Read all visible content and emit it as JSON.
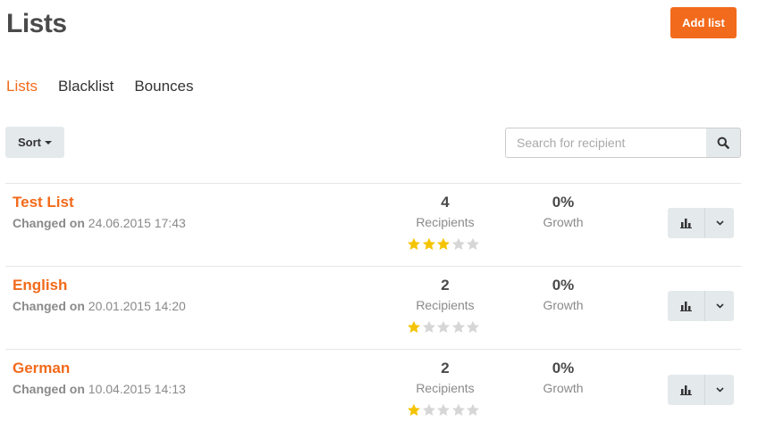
{
  "header": {
    "title": "Lists",
    "add_button_label": "Add list"
  },
  "tabs": [
    {
      "label": "Lists",
      "active": true
    },
    {
      "label": "Blacklist",
      "active": false
    },
    {
      "label": "Bounces",
      "active": false
    }
  ],
  "toolbar": {
    "sort_label": "Sort",
    "search_placeholder": "Search for recipient",
    "search_value": ""
  },
  "colors": {
    "accent": "#f26a1b",
    "star_on": "#f5c400",
    "star_off": "#d6d6d6",
    "button_bg": "#e4e9ec"
  },
  "icons": {
    "search": "search-icon",
    "chart": "bar-chart-icon",
    "dropdown": "chevron-down-icon",
    "rating": "star-icon"
  },
  "rows": [
    {
      "name": "Test List",
      "changed_label": "Changed on",
      "changed_date": "24.06.2015 17:43",
      "recipients": "4",
      "recipients_label": "Recipients",
      "growth": "0%",
      "growth_label": "Growth",
      "rating": 3
    },
    {
      "name": "English",
      "changed_label": "Changed on",
      "changed_date": "20.01.2015 14:20",
      "recipients": "2",
      "recipients_label": "Recipients",
      "growth": "0%",
      "growth_label": "Growth",
      "rating": 1
    },
    {
      "name": "German",
      "changed_label": "Changed on",
      "changed_date": "10.04.2015 14:13",
      "recipients": "2",
      "recipients_label": "Recipients",
      "growth": "0%",
      "growth_label": "Growth",
      "rating": 1
    }
  ]
}
